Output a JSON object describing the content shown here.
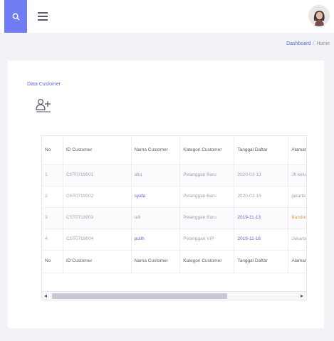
{
  "topbar": {
    "search_icon": "search-icon",
    "menu_icon": "hamburger-menu-icon",
    "avatar_icon": "user-avatar"
  },
  "breadcrumb": {
    "items": [
      "Dashboard",
      "Home"
    ],
    "separator": "/"
  },
  "card": {
    "title": "Data Customer",
    "add_icon": "add-user-icon"
  },
  "table": {
    "headers": [
      "No",
      "ID Customer",
      "Nama Customer",
      "Kategori Customer",
      "Tanggal Daftar",
      "Alamat"
    ],
    "rows": [
      {
        "no": "1",
        "id": "CST0719001",
        "nama": "afiq",
        "kategori": "Pelanggan Baru",
        "tanggal": "2020-01-13",
        "alamat": "Jlt kelurahan"
      },
      {
        "no": "2",
        "id": "CST0719002",
        "nama": "syafa",
        "kategori": "Pelanggan Baru",
        "tanggal": "2020-01-13",
        "alamat": "jakarta"
      },
      {
        "no": "3",
        "id": "CST0719003",
        "nama": "udi",
        "kategori": "Pelanggan Baru",
        "tanggal": "2019-11-13",
        "alamat": "Bandung"
      },
      {
        "no": "4",
        "id": "CST0719004",
        "nama": "putih",
        "kategori": "Pelanggan VIP",
        "tanggal": "2019-11-16",
        "alamat": "Jakarta Utara"
      }
    ],
    "footer": [
      "No",
      "ID Customer",
      "Nama Customer",
      "Kategori Customer",
      "Tanggal Daftar",
      "Alamat"
    ]
  },
  "scrollbar": {
    "left_arrow": "◂",
    "right_arrow": "▸"
  },
  "colors": {
    "accent": "#6f7cf2",
    "link": "#5867dd",
    "warning": "#e6a23c"
  }
}
